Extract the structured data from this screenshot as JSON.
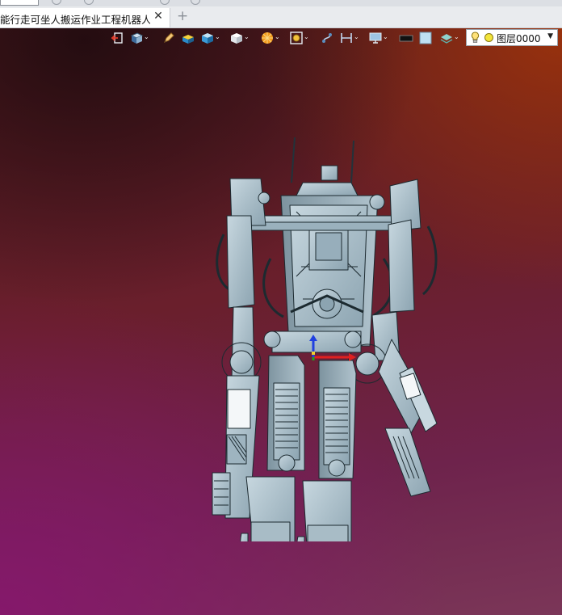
{
  "title_bar": {},
  "document_tab": {
    "title": "能行走可坐人搬运作业工程机器人]",
    "close_glyph": "✕",
    "new_tab_glyph": "+"
  },
  "toolbar": {
    "tools": [
      {
        "name": "exit-icon",
        "dropdown": false
      },
      {
        "name": "view-style-icon",
        "dropdown": true
      },
      {
        "name": "pencil-icon",
        "dropdown": false
      },
      {
        "name": "render-mode-icon",
        "dropdown": false
      },
      {
        "name": "shaded-cube-icon",
        "dropdown": true
      },
      {
        "name": "view-cube-icon",
        "dropdown": true
      },
      {
        "name": "color-wheel-icon",
        "dropdown": true
      },
      {
        "name": "zoom-fit-icon",
        "dropdown": true
      },
      {
        "name": "connect-icon",
        "dropdown": false
      },
      {
        "name": "dimension-icon",
        "dropdown": true
      },
      {
        "name": "monitor-icon",
        "dropdown": true
      },
      {
        "name": "black-rectangle-icon",
        "dropdown": false
      },
      {
        "name": "light-blue-square-icon",
        "dropdown": false
      },
      {
        "name": "layers-stack-icon",
        "dropdown": true
      }
    ],
    "layer": {
      "value": "图层0000",
      "dropdown_glyph": "▼"
    }
  },
  "viewport": {
    "model": "walking-loader-robot"
  },
  "colors": {
    "model_fill": "#b4c8d2",
    "model_edge": "#1c2a30",
    "axis_x": "#e02020",
    "axis_y": "#20a020",
    "axis_z": "#2040e0"
  }
}
